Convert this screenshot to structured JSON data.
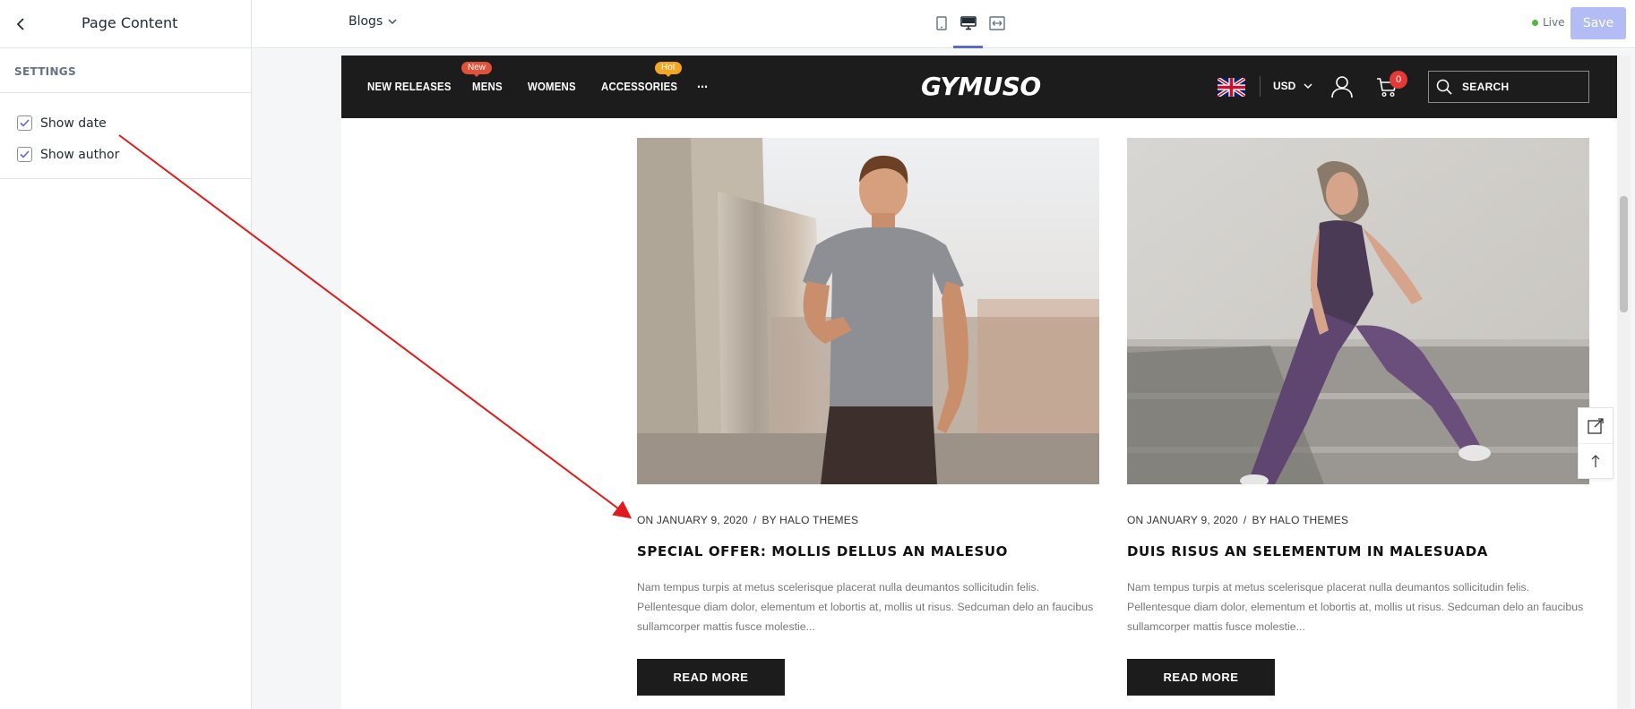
{
  "editor": {
    "sidebar_title": "Page Content",
    "section_label": "SETTINGS",
    "options": [
      {
        "label": "Show date",
        "checked": true
      },
      {
        "label": "Show author",
        "checked": true
      }
    ],
    "page_selector": "Blogs",
    "live_label": "Live",
    "save_label": "Save",
    "accent_color": "#5c6ac4"
  },
  "store": {
    "nav": {
      "new_releases": "NEW RELEASES",
      "mens": "MENS",
      "mens_badge": "New",
      "womens": "WOMENS",
      "accessories": "ACCESSORIES",
      "accessories_badge": "Hot",
      "more": "...",
      "logo": "GYMUSO",
      "currency": "USD",
      "cart_count": "0",
      "search_placeholder": "SEARCH"
    },
    "posts": [
      {
        "date": "ON JANUARY 9, 2020",
        "separator": "/",
        "author": "BY HALO THEMES",
        "title": "SPECIAL OFFER: MOLLIS DELLUS AN MALESUO",
        "excerpt": "Nam tempus turpis at metus scelerisque placerat nulla deumantos sollicitudin felis. Pellentesque diam dolor, elementum et lobortis at, mollis ut risus. Sedcuman delo an faucibus sullamcorper mattis fusce molestie...",
        "button": "READ MORE"
      },
      {
        "date": "ON JANUARY 9, 2020",
        "separator": "/",
        "author": "BY HALO THEMES",
        "title": "DUIS RISUS AN SELEMENTUM IN MALESUADA",
        "excerpt": "Nam tempus turpis at metus scelerisque placerat nulla deumantos sollicitudin felis. Pellentesque diam dolor, elementum et lobortis at, mollis ut risus. Sedcuman delo an faucibus sullamcorper mattis fusce molestie...",
        "button": "READ MORE"
      }
    ]
  },
  "colors": {
    "nav_bg": "#1c1c1c",
    "badge_new": "#e0523a",
    "badge_hot": "#f5a623",
    "cart_badge": "#e53935",
    "annotation_arrow": "#e01b1b"
  }
}
